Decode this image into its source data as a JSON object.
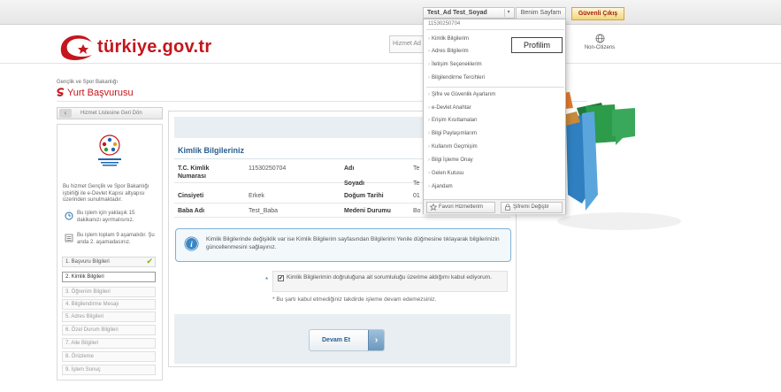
{
  "header": {
    "logo_text": "türkiye.gov.tr",
    "search_placeholder": "Hizmet Ad",
    "language_label": "Non-Citizens"
  },
  "userbar": {
    "user_name": "Test_Ad Test_Soyad",
    "my_page": "Benim Sayfam",
    "logout": "Güvenli Çıkış"
  },
  "user_menu": {
    "tc_no": "11530250704",
    "group1": [
      "Kimlik Bilgilerim",
      "Adres Bilgilerim",
      "İletişim Seçeneklerim",
      "Bilgilendirme Tercihleri"
    ],
    "group2": [
      "Şifre ve Güvenlik Ayarlarım",
      "e-Devlet Anahtar",
      "Erişim Kısıtlamaları",
      "Bilgi Paylaşımlarım",
      "Kullanım Geçmişim",
      "Bilgi İşleme Onay",
      "Gelen Kutusu",
      "Ajandam"
    ],
    "favorites_button": "Favori Hizmetlerim",
    "password_button": "Şifremi Değiştir",
    "tooltip": "Profilim"
  },
  "page": {
    "ministry": "Gençlik ve Spor Bakanlığı",
    "service_title": "Yurt Başvurusu"
  },
  "left_panel": {
    "back_button": "Hizmet Listesine Geri Dön",
    "description": "Bu hizmet Gençlik ve Spor Bakanlığı işbirliği ile e-Devlet Kapısı altyapısı üzerinden sunulmaktadır.",
    "time_note": "Bu işlem için yaklaşık 15 dakikanızı ayırmalısınız.",
    "steps_note": "Bu işlem toplam 9 aşamalıdır. Şu anda 2. aşamadasınız.",
    "steps": [
      "1. Başvuru Bilgileri",
      "2. Kimlik Bilgileri",
      "3. Öğrenim Bilgileri",
      "4. Bilgilendirme Mesajı",
      "5. Adres Bilgileri",
      "6. Özel Durum Bilgileri",
      "7. Aile Bilgileri",
      "8. Önizleme",
      "9. İşlem Sonuç"
    ]
  },
  "form": {
    "title": "Kimlik Bilgileriniz",
    "tc_label": "T.C. Kimlik Numarası",
    "tc_value": "11530250704",
    "ad_label": "Adı",
    "ad_value": "Te",
    "soyad_label": "Soyadı",
    "soyad_value": "Te",
    "cinsiyet_label": "Cinsiyeti",
    "cinsiyet_value": "Erkek",
    "dogum_label": "Doğum Tarihi",
    "dogum_value": "01",
    "baba_label": "Baba Adı",
    "baba_value": "Test_Baba",
    "medeni_label": "Medeni Durumu",
    "medeni_value": "Bo"
  },
  "info": {
    "text": "Kimlik Bilgilerinde değişiklik var ise Kimlik Bilgilerim sayfasından Bilgilerimi Yenile düğmesine tıklayarak bilgilerinizin güncellenmesini sağlayınız."
  },
  "consent": {
    "checkbox_label": "Kimlik Bilgilerimin doğruluğuna ait sorumluluğu üzerime aldığımı kabul ediyorum.",
    "note": "* Bu şartı kabul etmediğiniz takdirde işleme devam edemezsiniz."
  },
  "actions": {
    "next": "Devam Et"
  }
}
